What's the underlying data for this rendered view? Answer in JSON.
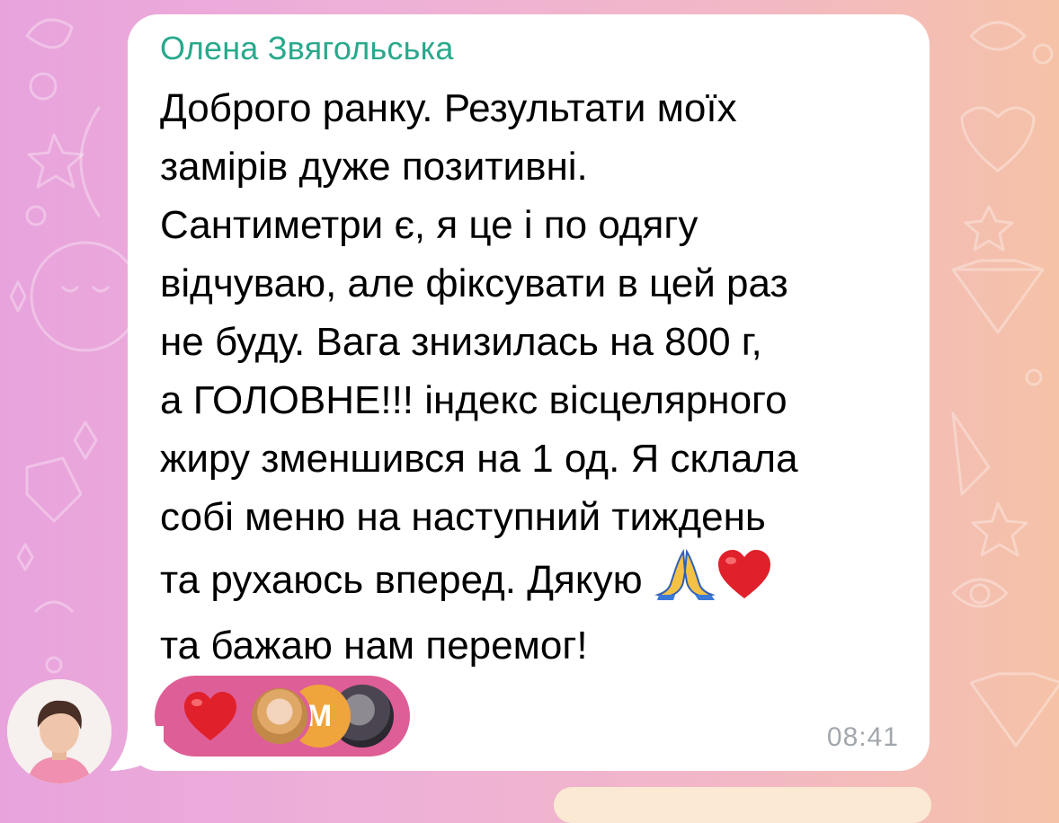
{
  "message": {
    "sender_name": "Олена Звягольська",
    "text_before_emoji": "Доброго ранку. Результати моїх\nзамірів дуже позитивні.\nСантиметри є, я це і по одягу\nвідчуваю, але фіксувати в цей раз\nне буду. Вага знизилась на 800 г,\nа ГОЛОВНЕ!!! індекс вісцелярного\nжиру зменшився на 1 од. Я склала\nсобі меню на наступний тиждень\nта рухаюсь вперед. Дякую ",
    "text_after_emoji": "\nта бажаю нам перемог!",
    "inline_emojis": [
      "folded-hands-icon",
      "red-heart-icon"
    ],
    "time": "08:41"
  },
  "reactions": {
    "emoji": "red-heart-icon",
    "reactor_initial": "М"
  },
  "colors": {
    "sender_name": "#28a98c",
    "reaction_pill": "#de5e97",
    "timestamp": "#a2a7ad",
    "bubble": "#ffffff"
  }
}
